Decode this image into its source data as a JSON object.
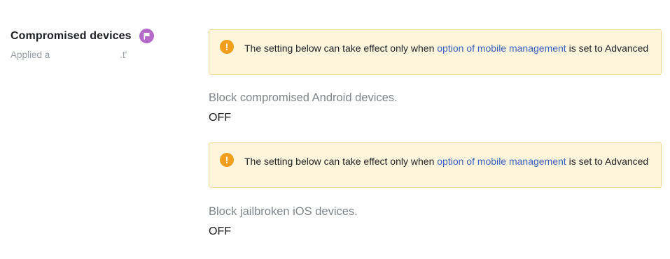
{
  "section": {
    "title": "Compromised devices",
    "applied": "Applied a",
    "applied_tail": ".t'"
  },
  "icons": {
    "badge": "flag-icon",
    "warning": "exclamation-icon"
  },
  "warning": {
    "prefix": "The setting below can take effect only when ",
    "link": "option of mobile management",
    "suffix": " is set to Advanced"
  },
  "settings": [
    {
      "label": "Block compromised Android devices.",
      "value": "OFF"
    },
    {
      "label": "Block jailbroken iOS devices.",
      "value": "OFF"
    }
  ],
  "colors": {
    "badge": "#b56ac9",
    "warning_bg": "#fdf6dd",
    "warning_border": "#f1d98f",
    "warning_icon": "#f29e1c",
    "link": "#3b5fc0"
  }
}
